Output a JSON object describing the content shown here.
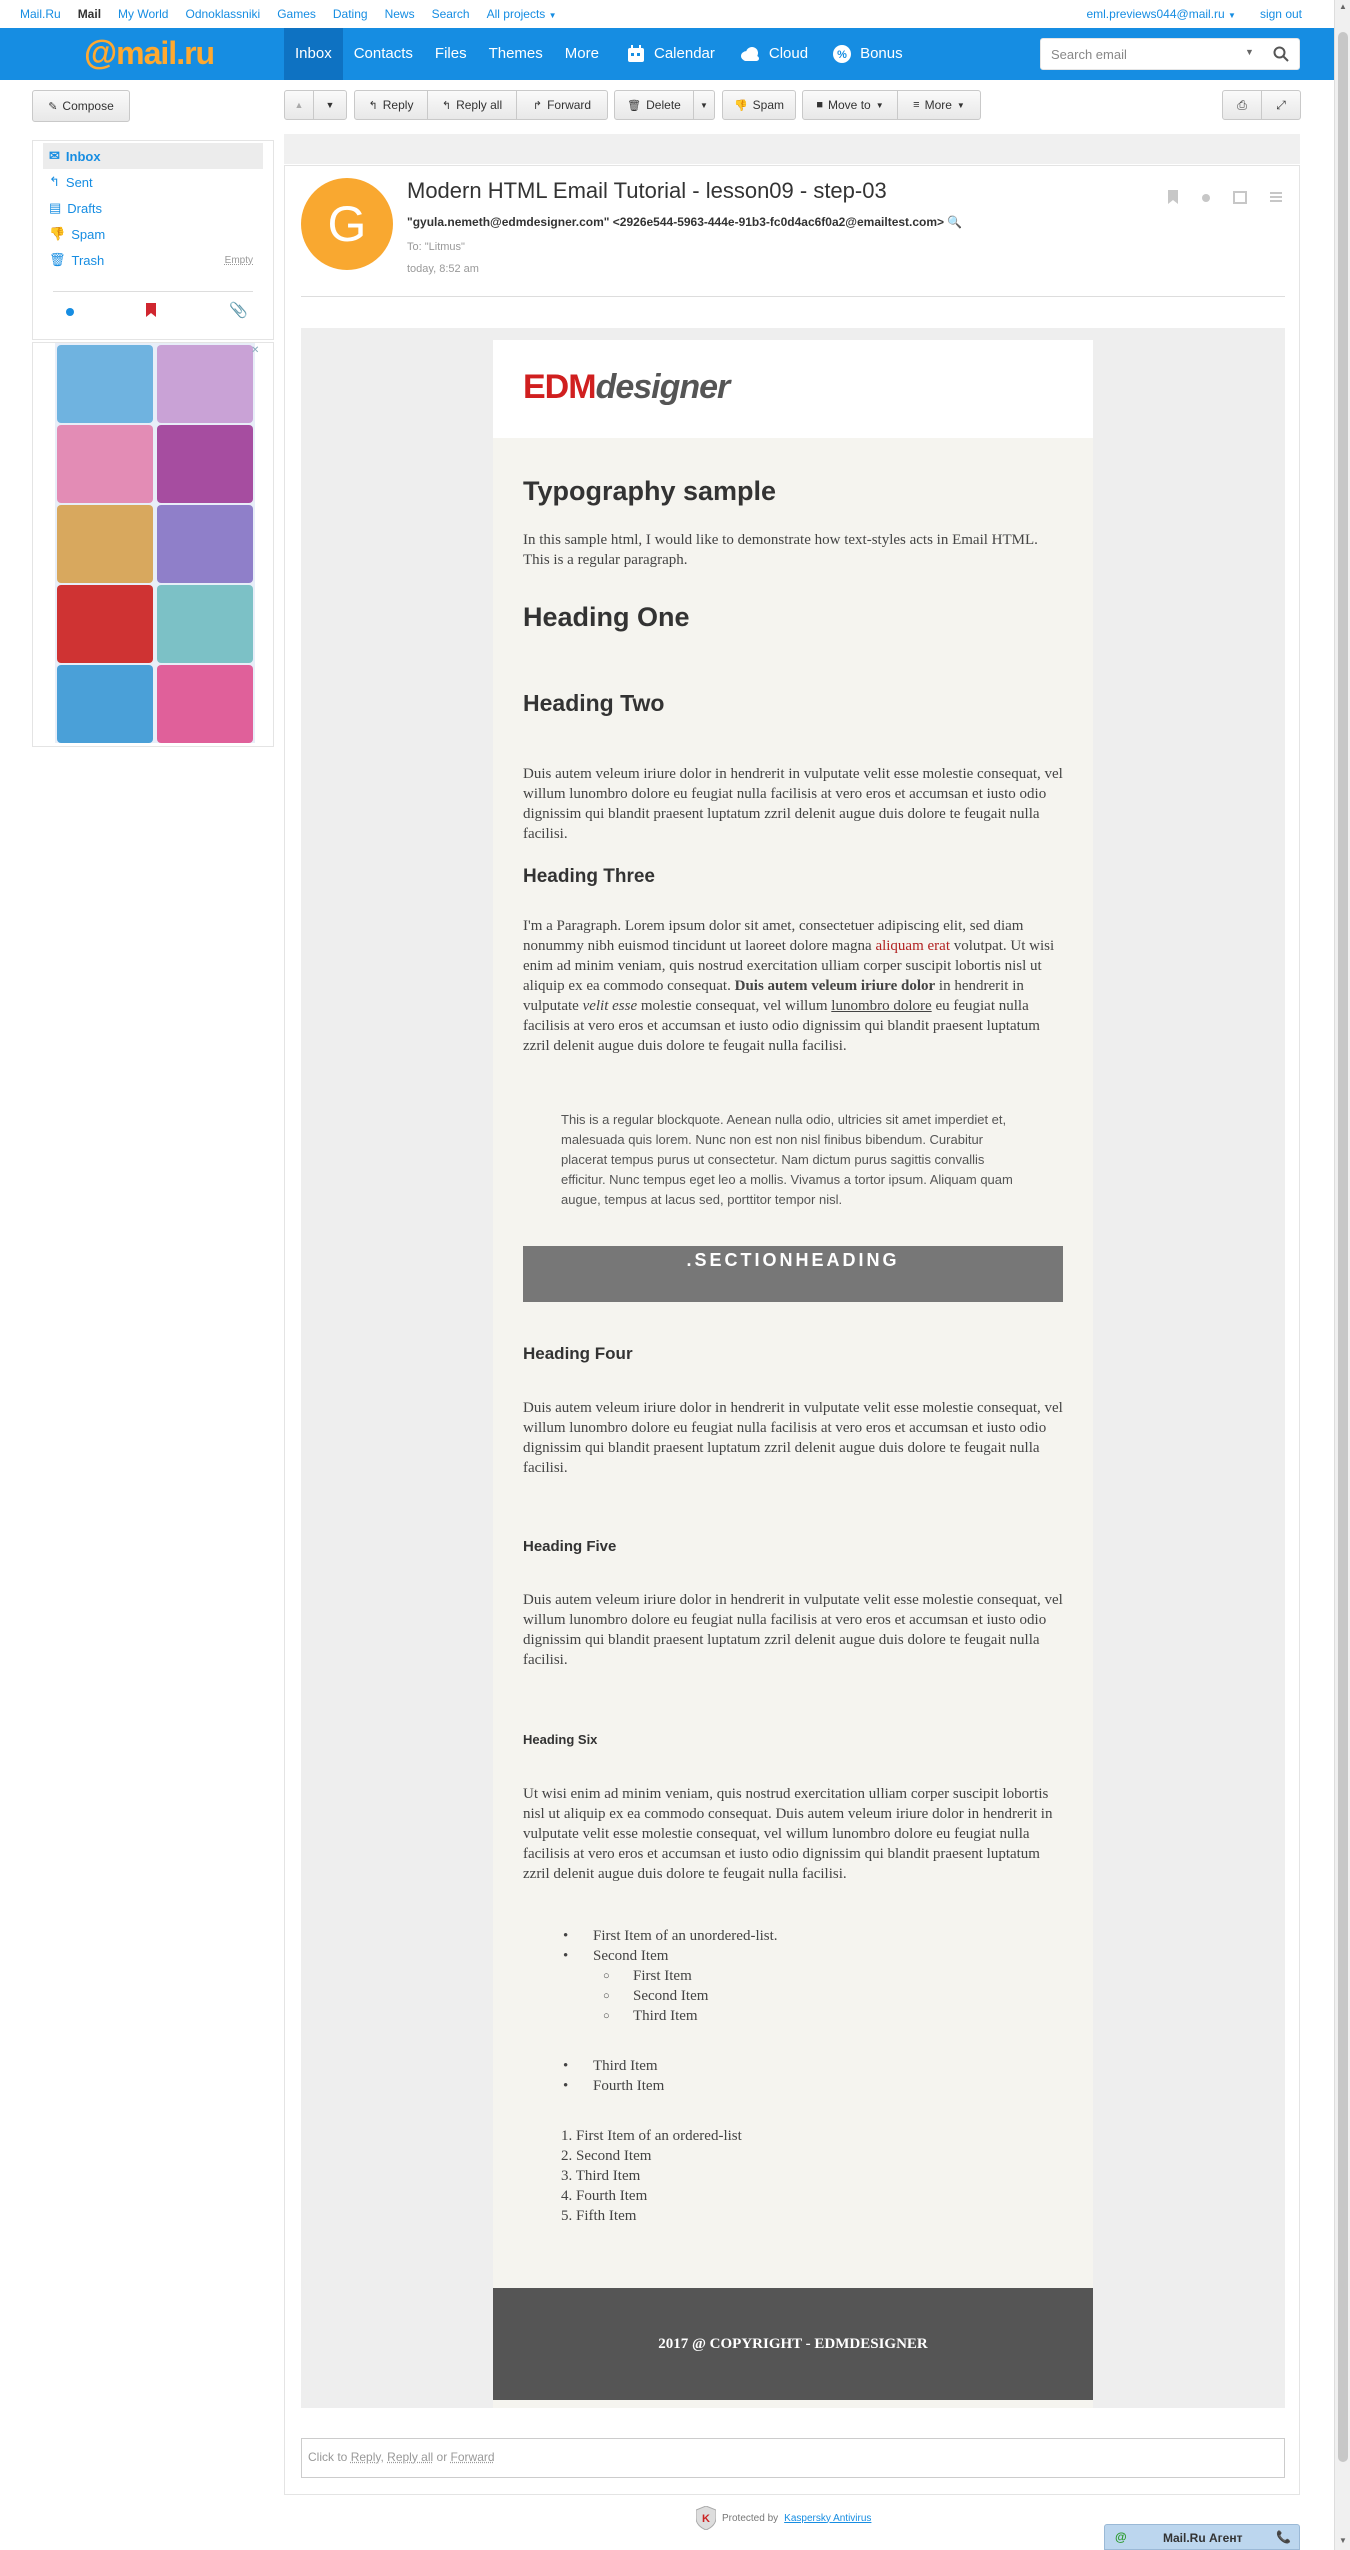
{
  "portal": {
    "links": [
      "Mail.Ru",
      "Mail",
      "My World",
      "Odnoklassniki",
      "Games",
      "Dating",
      "News",
      "Search",
      "All projects"
    ],
    "user_email": "eml.previews044@mail.ru",
    "signout": "sign out"
  },
  "header": {
    "logo_at": "@",
    "logo_text": "mail.ru",
    "nav": [
      "Inbox",
      "Contacts",
      "Files",
      "Themes",
      "More"
    ],
    "nav_icons": [
      {
        "label": "Calendar",
        "icon": "calendar-icon"
      },
      {
        "label": "Cloud",
        "icon": "cloud-icon"
      },
      {
        "label": "Bonus",
        "icon": "bonus-icon"
      }
    ],
    "search_placeholder": "Search email"
  },
  "toolbar": {
    "compose": "Compose",
    "reply": "Reply",
    "reply_all": "Reply all",
    "forward": "Forward",
    "delete": "Delete",
    "spam": "Spam",
    "move_to": "Move to",
    "more": "More"
  },
  "sidebar": {
    "folders": [
      {
        "label": "Inbox",
        "icon": "inbox-icon",
        "active": true
      },
      {
        "label": "Sent",
        "icon": "sent-icon"
      },
      {
        "label": "Drafts",
        "icon": "drafts-icon"
      },
      {
        "label": "Spam",
        "icon": "spam-icon"
      },
      {
        "label": "Trash",
        "icon": "trash-icon"
      }
    ],
    "empty_label": "Empty"
  },
  "message": {
    "avatar_letter": "G",
    "subject": "Modern HTML Email Tutorial - lesson09 - step-03",
    "from": "\"gyula.nemeth@edmdesigner.com\" <2926e544-5963-444e-91b3-fc0d4ac6f0a2@emailtest.com>",
    "to": "To: \"Litmus\"",
    "date": "today, 8:52 am"
  },
  "email": {
    "logo_a": "EDM",
    "logo_b": "designer",
    "title": "Typography sample",
    "intro": "In this sample html, I would like to demonstrate how text-styles acts in Email HTML. This is a regular paragraph.",
    "h1": "Heading One",
    "h2": "Heading Two",
    "p1": "Duis autem veleum iriure dolor in hendrerit in vulputate velit esse molestie consequat, vel willum lunombro dolore eu feugiat nulla facilisis at vero eros et accumsan et iusto odio dignissim qui blandit praesent luptatum zzril delenit augue duis dolore te feugait nulla facilisi.",
    "h3": "Heading Three",
    "p2_a": "I'm a Paragraph. Lorem ipsum dolor sit amet, consectetuer adipiscing elit, sed diam nonummy nibh euismod tincidunt ut laoreet dolore magna ",
    "p2_link": "aliquam erat",
    "p2_b": " volutpat. Ut wisi enim ad minim veniam, quis nostrud exercitation ulliam corper suscipit lobortis nisl ut aliquip ex ea commodo consequat. ",
    "p2_bold": "Duis autem veleum iriure dolor",
    "p2_c": " in hendrerit in vulputate ",
    "p2_italic": "velit esse",
    "p2_d": " molestie consequat, vel willum ",
    "p2_under": "lunombro dolore",
    "p2_e": " eu feugiat nulla facilisis at vero eros et accumsan et iusto odio dignissim qui blandit praesent luptatum zzril delenit augue duis dolore te feugait nulla facilisi.",
    "quote": "This is a regular blockquote. Aenean nulla odio, ultricies sit amet imperdiet et, malesuada quis lorem. Nunc non est non nisl finibus bibendum. Curabitur placerat tempus purus ut consectetur. Nam dictum purus sagittis convallis efficitur. Nunc tempus eget leo a mollis. Vivamus a tortor ipsum. Aliquam quam augue, tempus at lacus sed, porttitor tempor nisl.",
    "section_heading": ".SECTIONHEADING",
    "h4": "Heading Four",
    "p3": "Duis autem veleum iriure dolor in hendrerit in vulputate velit esse molestie consequat, vel willum lunombro dolore eu feugiat nulla facilisis at vero eros et accumsan et iusto odio dignissim qui blandit praesent luptatum zzril delenit augue duis dolore te feugait nulla facilisi.",
    "h5": "Heading Five",
    "p4": "Duis autem veleum iriure dolor in hendrerit in vulputate velit esse molestie consequat, vel willum lunombro dolore eu feugiat nulla facilisis at vero eros et accumsan et iusto odio dignissim qui blandit praesent luptatum zzril delenit augue duis dolore te feugait nulla facilisi.",
    "h6": "Heading Six",
    "p5": "Ut wisi enim ad minim veniam, quis nostrud exercitation ulliam corper suscipit lobortis nisl ut aliquip ex ea commodo consequat. Duis autem veleum iriure dolor in hendrerit in vulputate velit esse molestie consequat, vel willum lunombro dolore eu feugiat nulla facilisis at vero eros et accumsan et iusto odio dignissim qui blandit praesent luptatum zzril delenit augue duis dolore te feugait nulla facilisi.",
    "ul": [
      "First Item of an unordered-list.",
      "Second Item"
    ],
    "ul_nested": [
      "First Item",
      "Second Item",
      "Third Item"
    ],
    "ul2": [
      "Third Item",
      "Fourth Item"
    ],
    "ol": [
      "1. First Item of an ordered-list",
      "2. Second Item",
      "3. Third Item",
      "4. Fourth Item",
      "5. Fifth Item"
    ],
    "footer": "2017 @ COPYRIGHT - EDMDESIGNER"
  },
  "reply_box": {
    "prefix": "Click to ",
    "reply": "Reply",
    "sep": ", ",
    "reply_all": "Reply all",
    "or": " or ",
    "forward": "Forward"
  },
  "footer": {
    "protected": "Protected by ",
    "kaspersky": "Kaspersky Antivirus",
    "agent": "Mail.Ru Агент"
  },
  "colors": {
    "brand_blue": "#168de2",
    "logo_orange": "#ffa930",
    "avatar": "#f9a830",
    "edm_red": "#d01f1f"
  }
}
